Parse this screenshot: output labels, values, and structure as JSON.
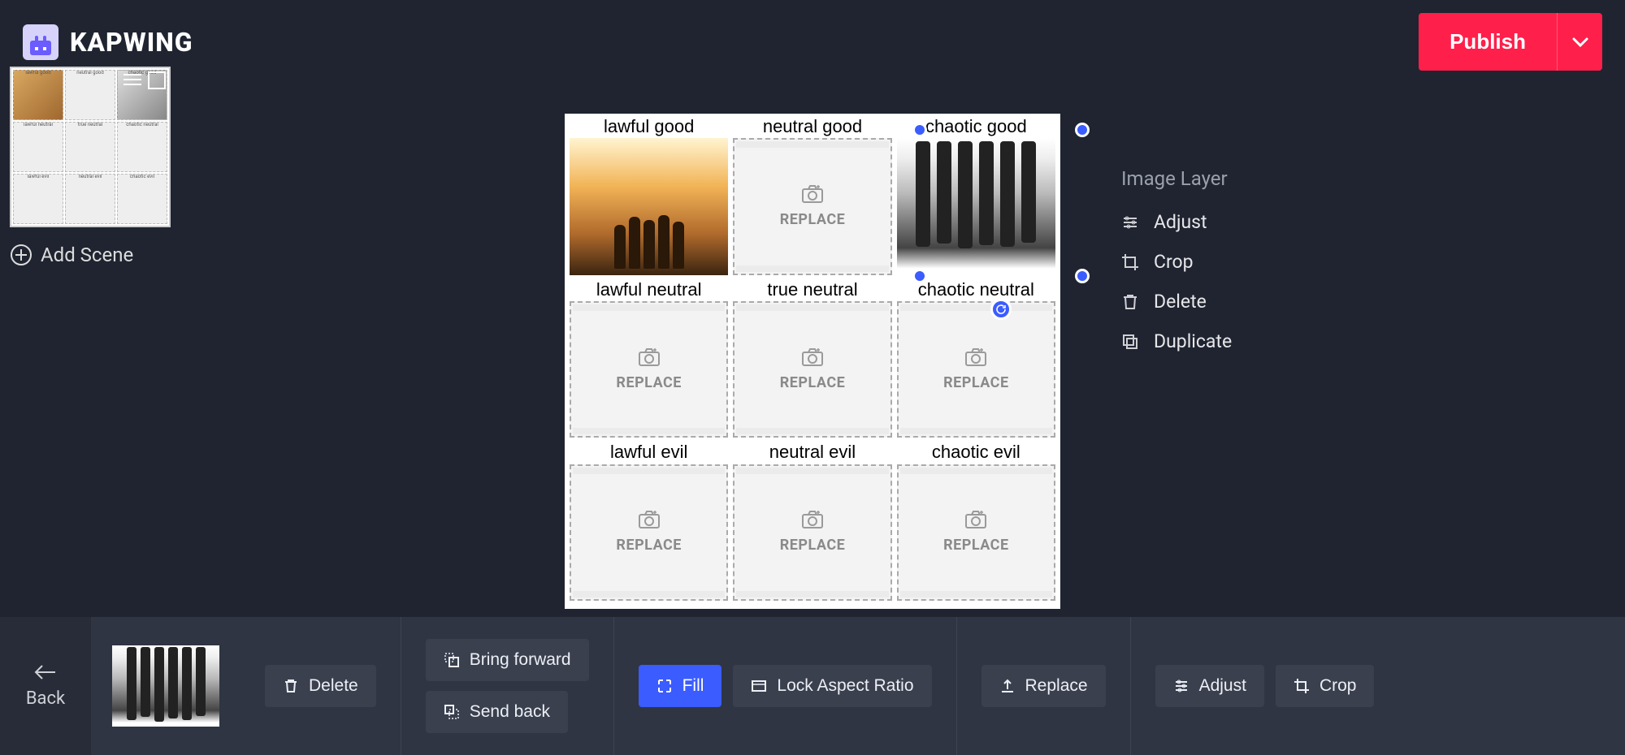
{
  "brand": {
    "name": "KAPWING"
  },
  "header": {
    "publish_label": "Publish"
  },
  "sidebar": {
    "add_scene_label": "Add Scene"
  },
  "canvas": {
    "cells": [
      {
        "label": "lawful good",
        "type": "image-sunset"
      },
      {
        "label": "neutral good",
        "type": "placeholder",
        "text": "REPLACE"
      },
      {
        "label": "chaotic good",
        "type": "image-bw",
        "selected": true
      },
      {
        "label": "lawful neutral",
        "type": "placeholder",
        "text": "REPLACE"
      },
      {
        "label": "true neutral",
        "type": "placeholder",
        "text": "REPLACE"
      },
      {
        "label": "chaotic neutral",
        "type": "placeholder",
        "text": "REPLACE"
      },
      {
        "label": "lawful evil",
        "type": "placeholder",
        "text": "REPLACE"
      },
      {
        "label": "neutral evil",
        "type": "placeholder",
        "text": "REPLACE"
      },
      {
        "label": "chaotic evil",
        "type": "placeholder",
        "text": "REPLACE"
      }
    ]
  },
  "right_panel": {
    "title": "Image Layer",
    "options": {
      "adjust": "Adjust",
      "crop": "Crop",
      "delete": "Delete",
      "duplicate": "Duplicate"
    }
  },
  "bottom": {
    "back": "Back",
    "delete": "Delete",
    "bring_forward": "Bring forward",
    "send_back": "Send back",
    "fill": "Fill",
    "lock_aspect": "Lock Aspect Ratio",
    "replace": "Replace",
    "adjust": "Adjust",
    "crop": "Crop"
  }
}
